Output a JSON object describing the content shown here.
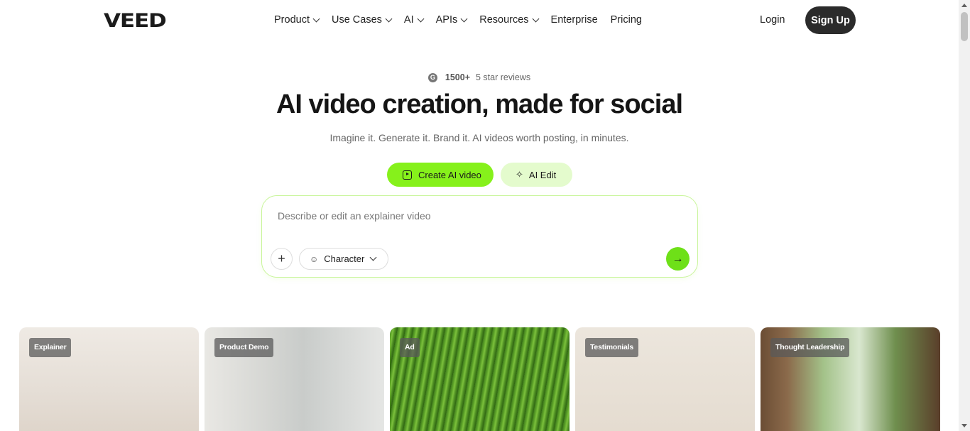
{
  "nav": {
    "logo": "VEED",
    "links": [
      {
        "label": "Product",
        "dropdown": true
      },
      {
        "label": "Use Cases",
        "dropdown": true
      },
      {
        "label": "AI",
        "dropdown": true
      },
      {
        "label": "APIs",
        "dropdown": true
      },
      {
        "label": "Resources",
        "dropdown": true
      },
      {
        "label": "Enterprise",
        "dropdown": false
      },
      {
        "label": "Pricing",
        "dropdown": false
      }
    ],
    "login": "Login",
    "signup": "Sign Up"
  },
  "hero": {
    "review_count": "1500+",
    "review_text": "5 star reviews",
    "headline": "AI video creation, made for social",
    "subline": "Imagine it. Generate it. Brand it. AI videos worth posting, in minutes.",
    "modes": {
      "create": "Create AI video",
      "edit": "AI Edit"
    },
    "prompt": {
      "placeholder": "Describe or edit an explainer video",
      "value": "",
      "character_label": "Character"
    }
  },
  "cards": [
    {
      "tag": "Explainer"
    },
    {
      "tag": "Product Demo"
    },
    {
      "tag": "Ad"
    },
    {
      "tag": "Testimonials"
    },
    {
      "tag": "Thought Leadership"
    }
  ],
  "colors": {
    "accent": "#86f11b",
    "accent_light": "#e4fbcd",
    "dark_button": "#2b2b2b"
  }
}
